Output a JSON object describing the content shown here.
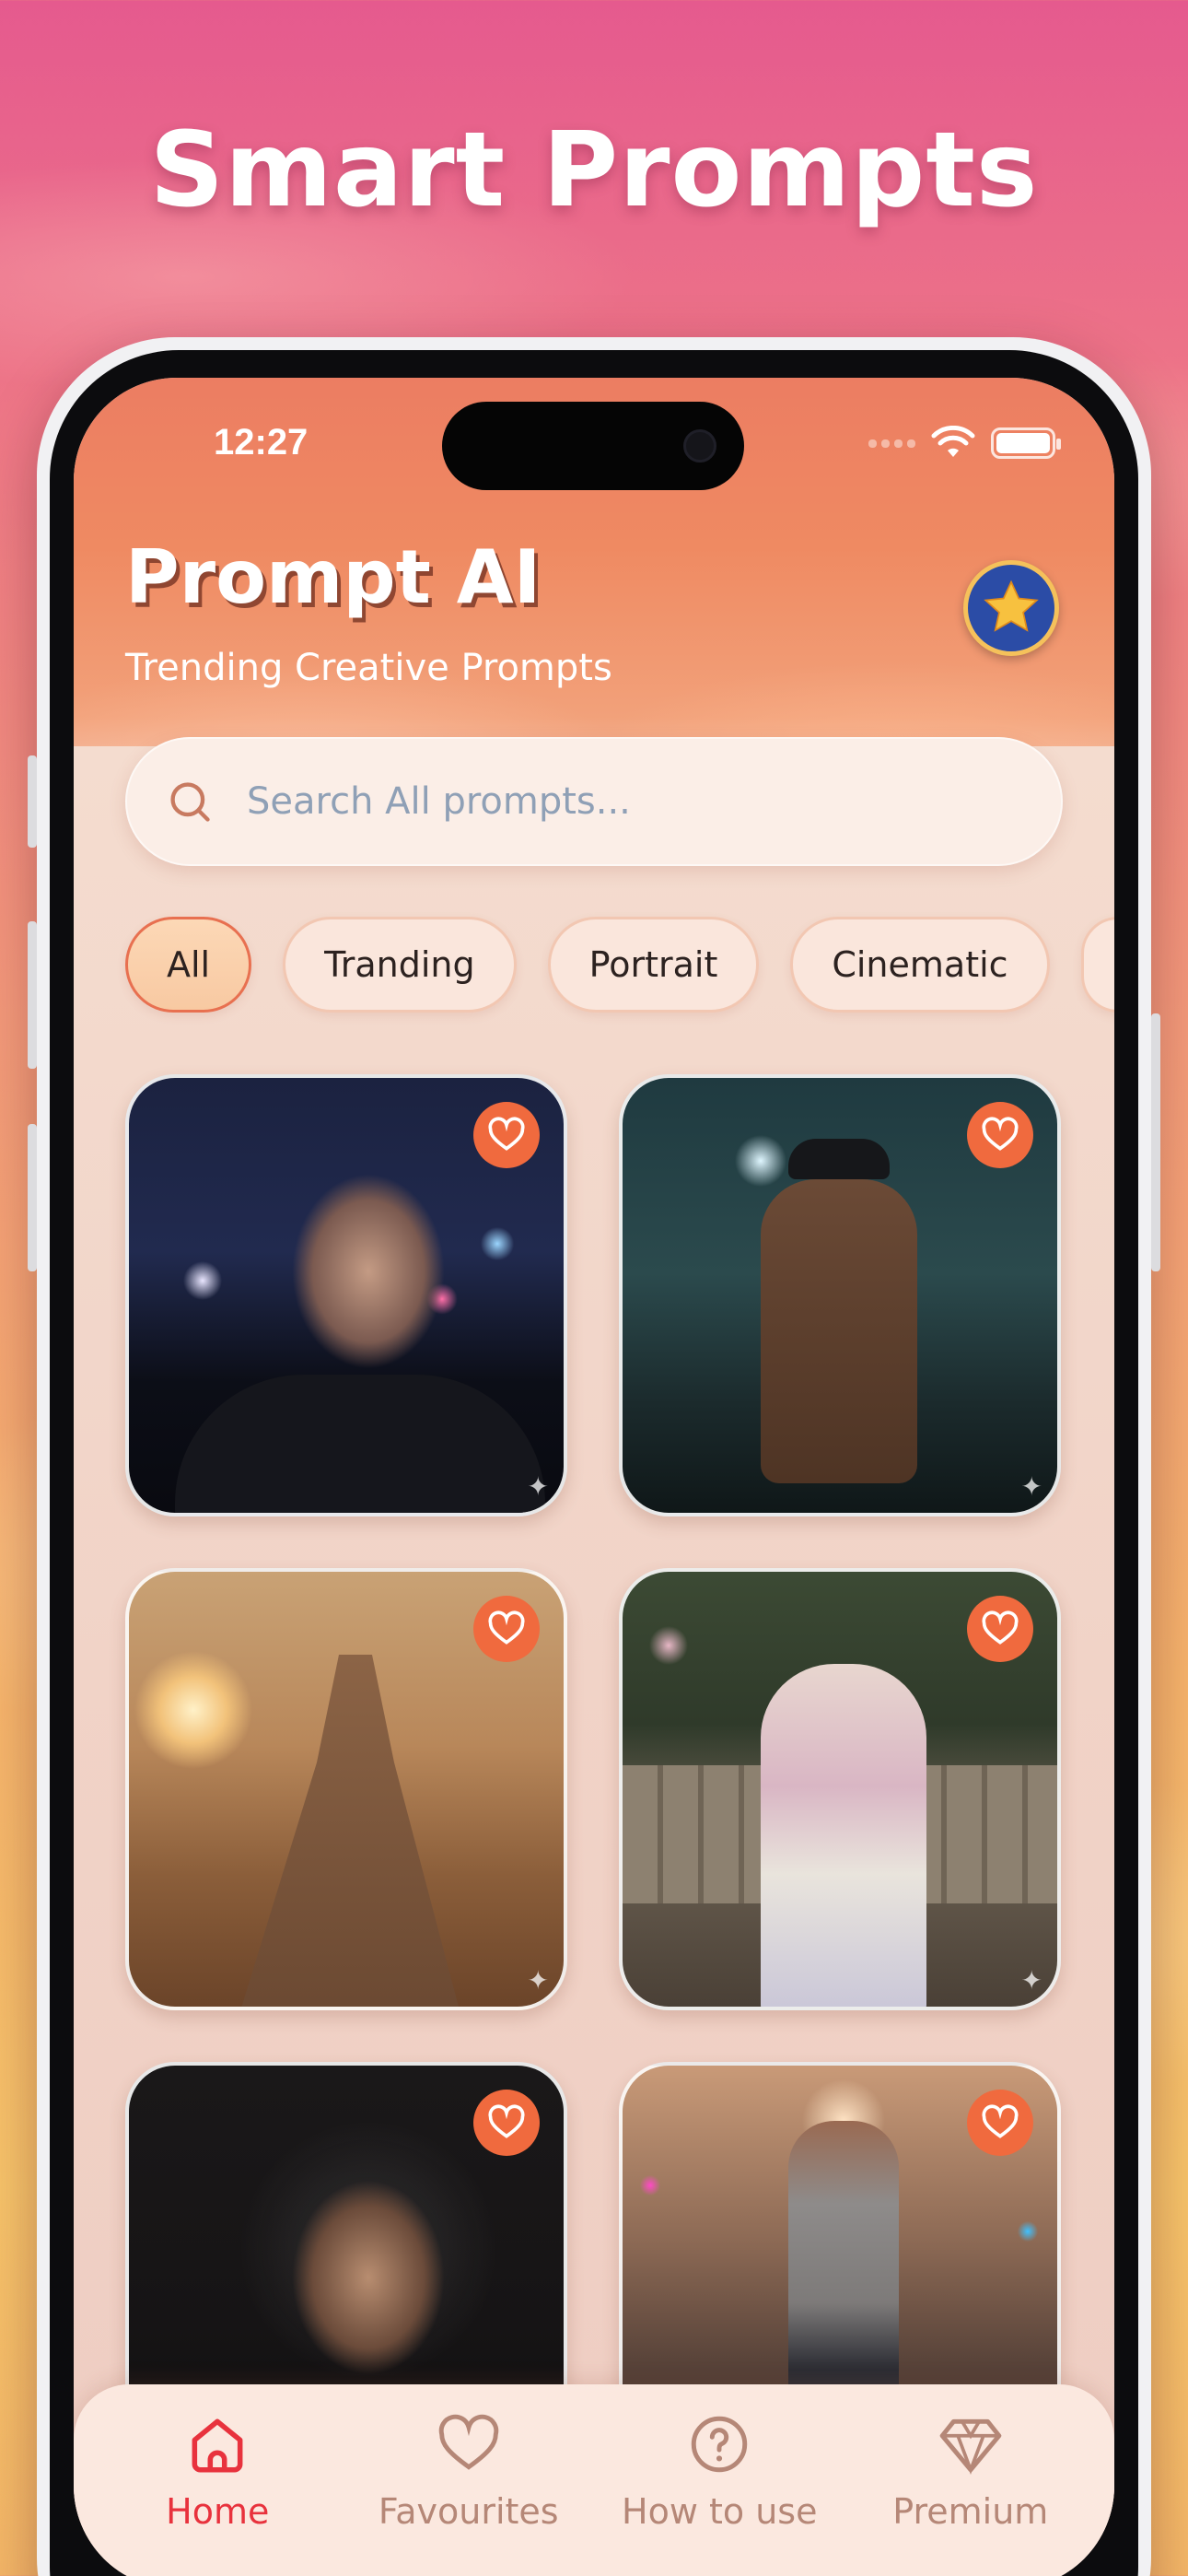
{
  "headline": "Smart Prompts",
  "status_bar": {
    "time": "12:27"
  },
  "header": {
    "title": "Prompt AI",
    "subtitle": "Trending Creative Prompts"
  },
  "search": {
    "placeholder": "Search All prompts..."
  },
  "filters": [
    {
      "label": "All",
      "active": true
    },
    {
      "label": "Tranding",
      "active": false
    },
    {
      "label": "Portrait",
      "active": false
    },
    {
      "label": "Cinematic",
      "active": false
    }
  ],
  "cards": [
    {
      "icon": "heart-icon",
      "image": "man-rain-neon-portrait"
    },
    {
      "icon": "heart-icon",
      "image": "man-trench-coat-alley"
    },
    {
      "icon": "heart-icon",
      "image": "woman-desert-sunset"
    },
    {
      "icon": "heart-icon",
      "image": "elderly-woman-bench"
    },
    {
      "icon": "heart-icon",
      "image": "man-smoke-portrait"
    },
    {
      "icon": "heart-icon",
      "image": "woman-city-street"
    }
  ],
  "tabbar": {
    "items": [
      {
        "label": "Home",
        "icon": "home-icon",
        "active": true
      },
      {
        "label": "Favourites",
        "icon": "heart-icon",
        "active": false
      },
      {
        "label": "How to use",
        "icon": "help-circle-icon",
        "active": false
      },
      {
        "label": "Premium",
        "icon": "diamond-icon",
        "active": false
      }
    ]
  },
  "colors": {
    "accent": "#f06a3e",
    "active_tab": "#e8323d",
    "inactive_tab": "#b58777",
    "premium_badge_bg": "#2b4ca6",
    "premium_star": "#f5c15b"
  }
}
